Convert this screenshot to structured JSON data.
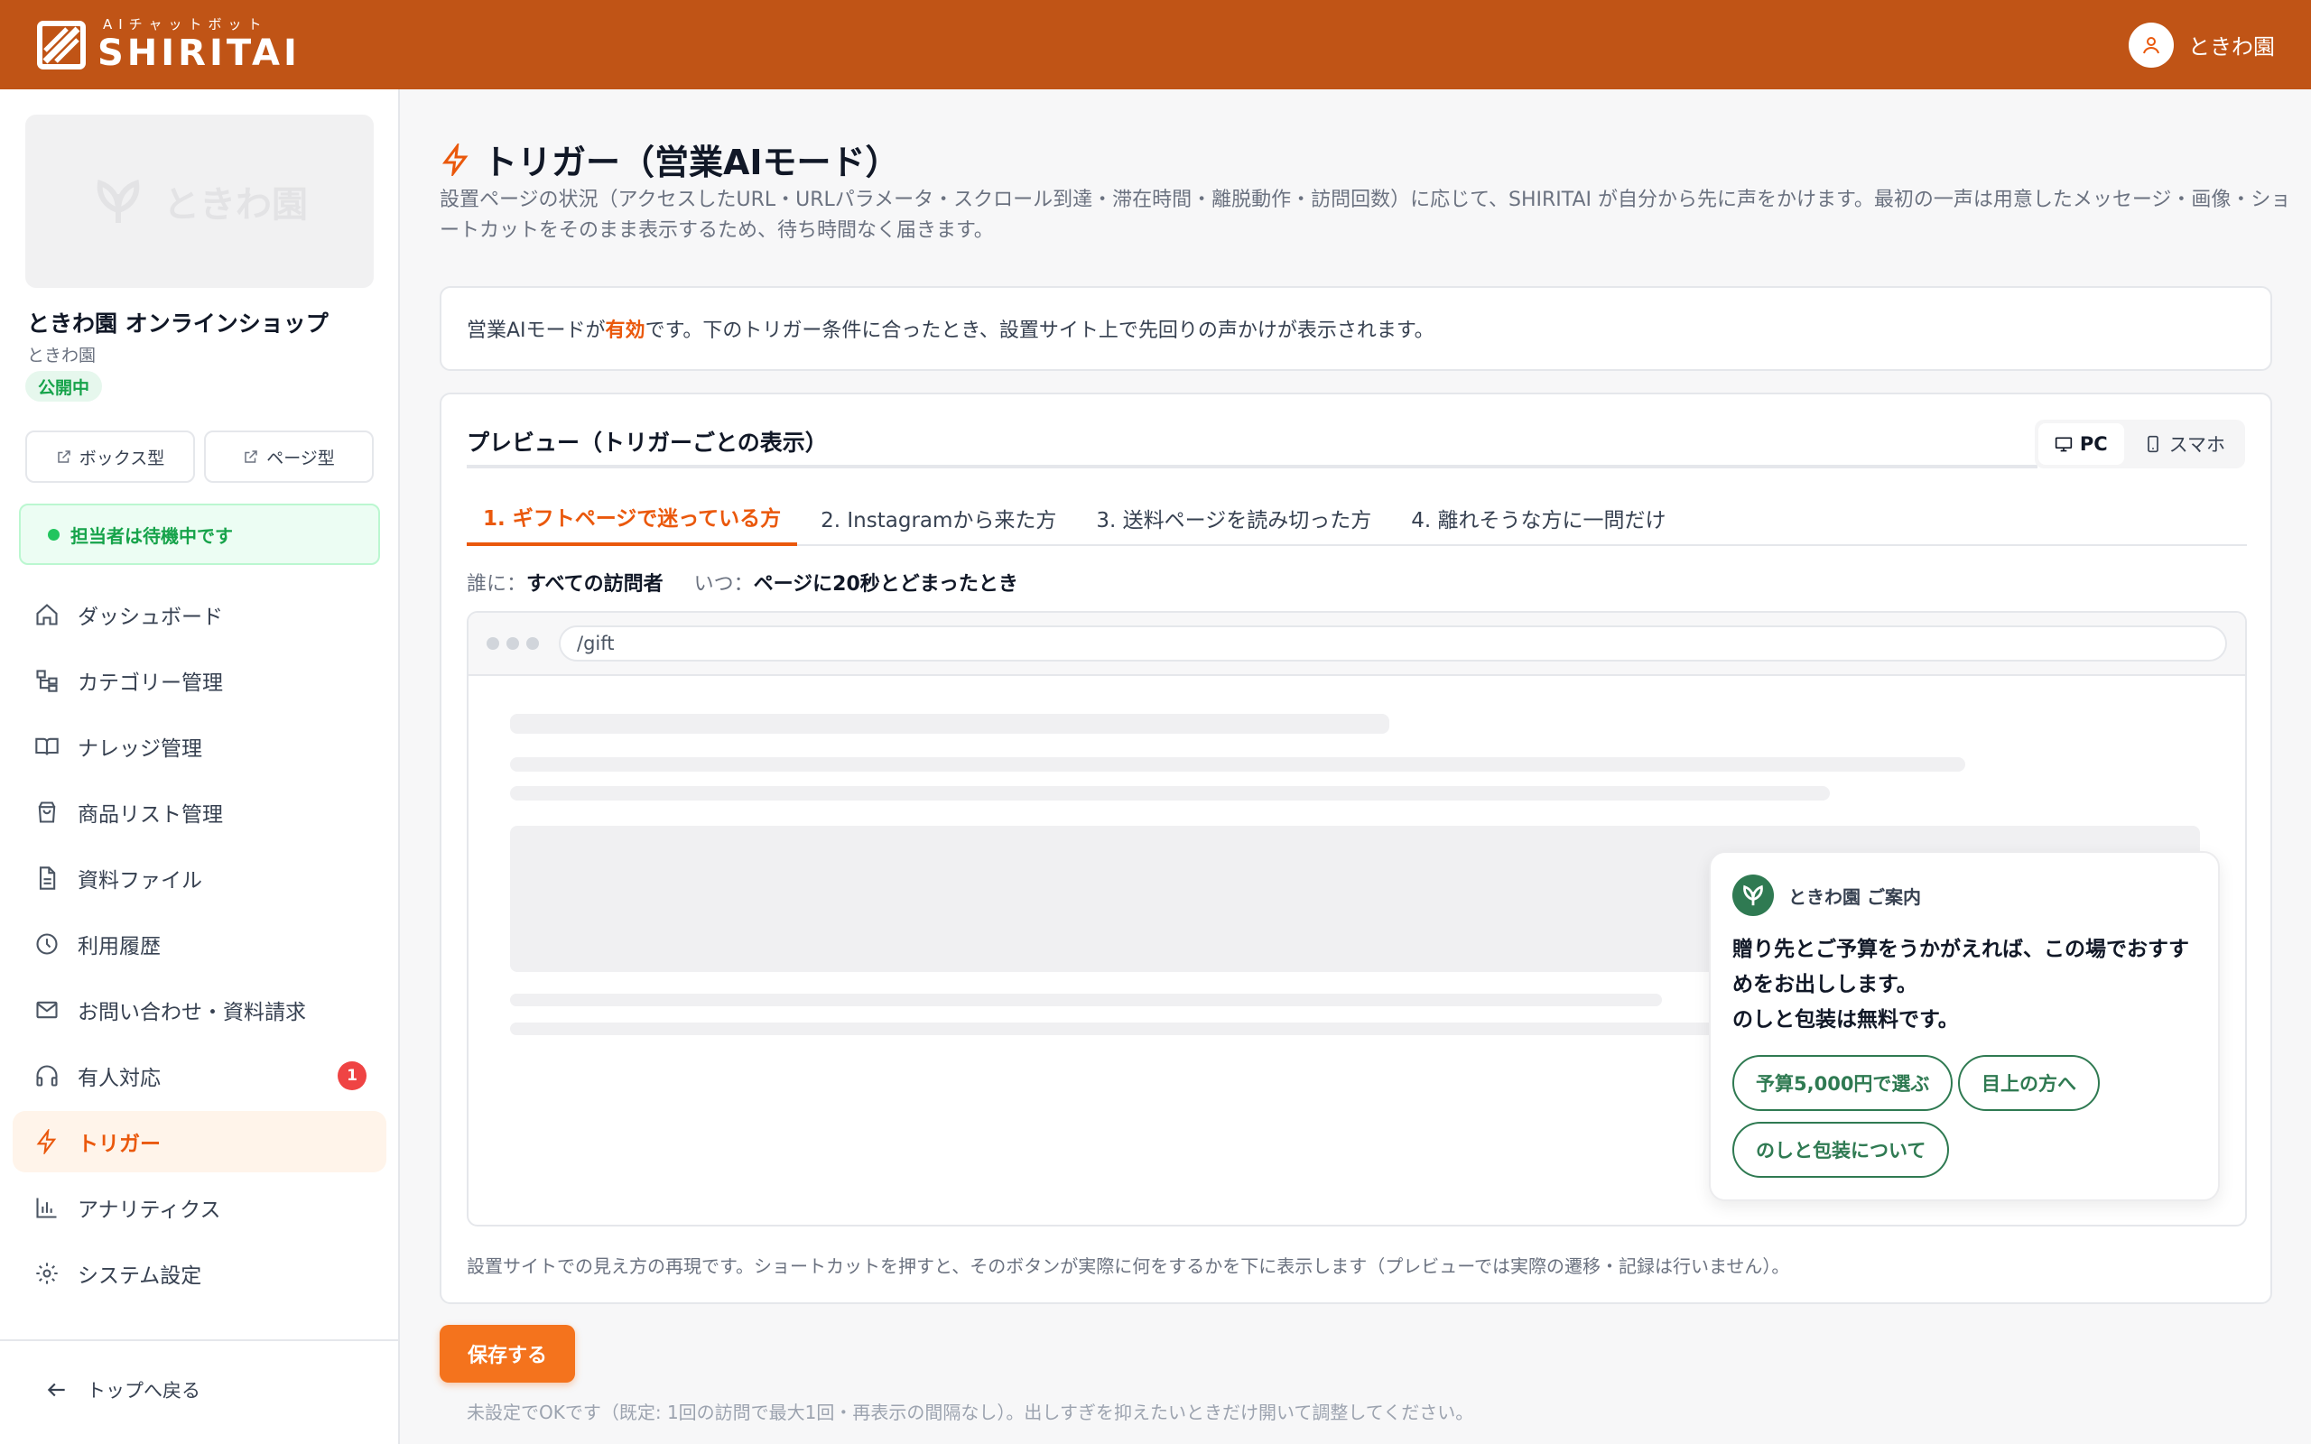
{
  "header": {
    "logo_sub": "AIチャットボット",
    "logo_main": "SHIRITAI",
    "user_name": "ときわ園"
  },
  "sidebar": {
    "thumb_text": "ときわ園",
    "shop_name": "ときわ園 オンラインショップ",
    "shop_sub": "ときわ園",
    "status_badge": "公開中",
    "box_btn": "ボックス型",
    "page_btn": "ページ型",
    "agent_status": "担当者は待機中です",
    "nav": [
      {
        "label": "ダッシュボード",
        "icon": "home-icon"
      },
      {
        "label": "カテゴリー管理",
        "icon": "category-icon"
      },
      {
        "label": "ナレッジ管理",
        "icon": "book-icon"
      },
      {
        "label": "商品リスト管理",
        "icon": "shopping-bag-icon"
      },
      {
        "label": "資料ファイル",
        "icon": "file-icon"
      },
      {
        "label": "利用履歴",
        "icon": "clock-icon"
      },
      {
        "label": "お問い合わせ・資料請求",
        "icon": "mail-icon"
      },
      {
        "label": "有人対応",
        "icon": "headphones-icon",
        "badge": "1"
      },
      {
        "label": "トリガー",
        "icon": "lightning-icon",
        "active": true
      },
      {
        "label": "アナリティクス",
        "icon": "chart-icon"
      },
      {
        "label": "システム設定",
        "icon": "gear-icon"
      }
    ],
    "back_label": "トップへ戻る"
  },
  "main": {
    "title": "トリガー（営業AIモード）",
    "description": "設置ページの状況（アクセスしたURL・URLパラメータ・スクロール到達・滞在時間・離脱動作・訪問回数）に応じて、SHIRITAI が自分から先に声をかけます。最初の一声は用意したメッセージ・画像・ショートカットをそのまま表示するため、待ち時間なく届きます。",
    "notice_pre": "営業AIモードが",
    "notice_hl": "有効",
    "notice_post": "です。下のトリガー条件に合ったとき、設置サイト上で先回りの声かけが表示されます。",
    "preview_title": "プレビュー（トリガーごとの表示）",
    "device_pc": "PC",
    "device_sp": "スマホ",
    "tabs": [
      "1. ギフトページで迷っている方",
      "2. Instagramから来た方",
      "3. 送料ページを読み切った方",
      "4. 離れそうな方に一問だけ"
    ],
    "who_label": "誰に：",
    "who_value": "すべての訪問者",
    "when_label": "いつ：",
    "when_value": "ページに20秒とどまったとき",
    "url": "/gift",
    "chat_title": "ときわ園 ご案内",
    "chat_message_1": "贈り先とご予算をうかがえれば、この場でおすすめをお出しします。",
    "chat_message_2": "のしと包装は無料です。",
    "chips": [
      "予算5,000円で選ぶ",
      "目上の方へ",
      "のしと包装について"
    ],
    "preview_foot": "設置サイトでの見え方の再現です。ショートカットを押すと、そのボタンが実際に何をするかを下に表示します（プレビューでは実際の遷移・記録は行いません）。",
    "save_label": "保存する",
    "bottom_note": "未設定でOKです（既定: 1回の訪問で最大1回・再表示の間隔なし）。出しすぎを抑えたいときだけ開いて調整してください。"
  },
  "colors": {
    "header": "#c05416",
    "accent": "#ea580c",
    "save_button": "#f4731d",
    "chat_green": "#2f7a52",
    "status_green": "#16a34a"
  }
}
